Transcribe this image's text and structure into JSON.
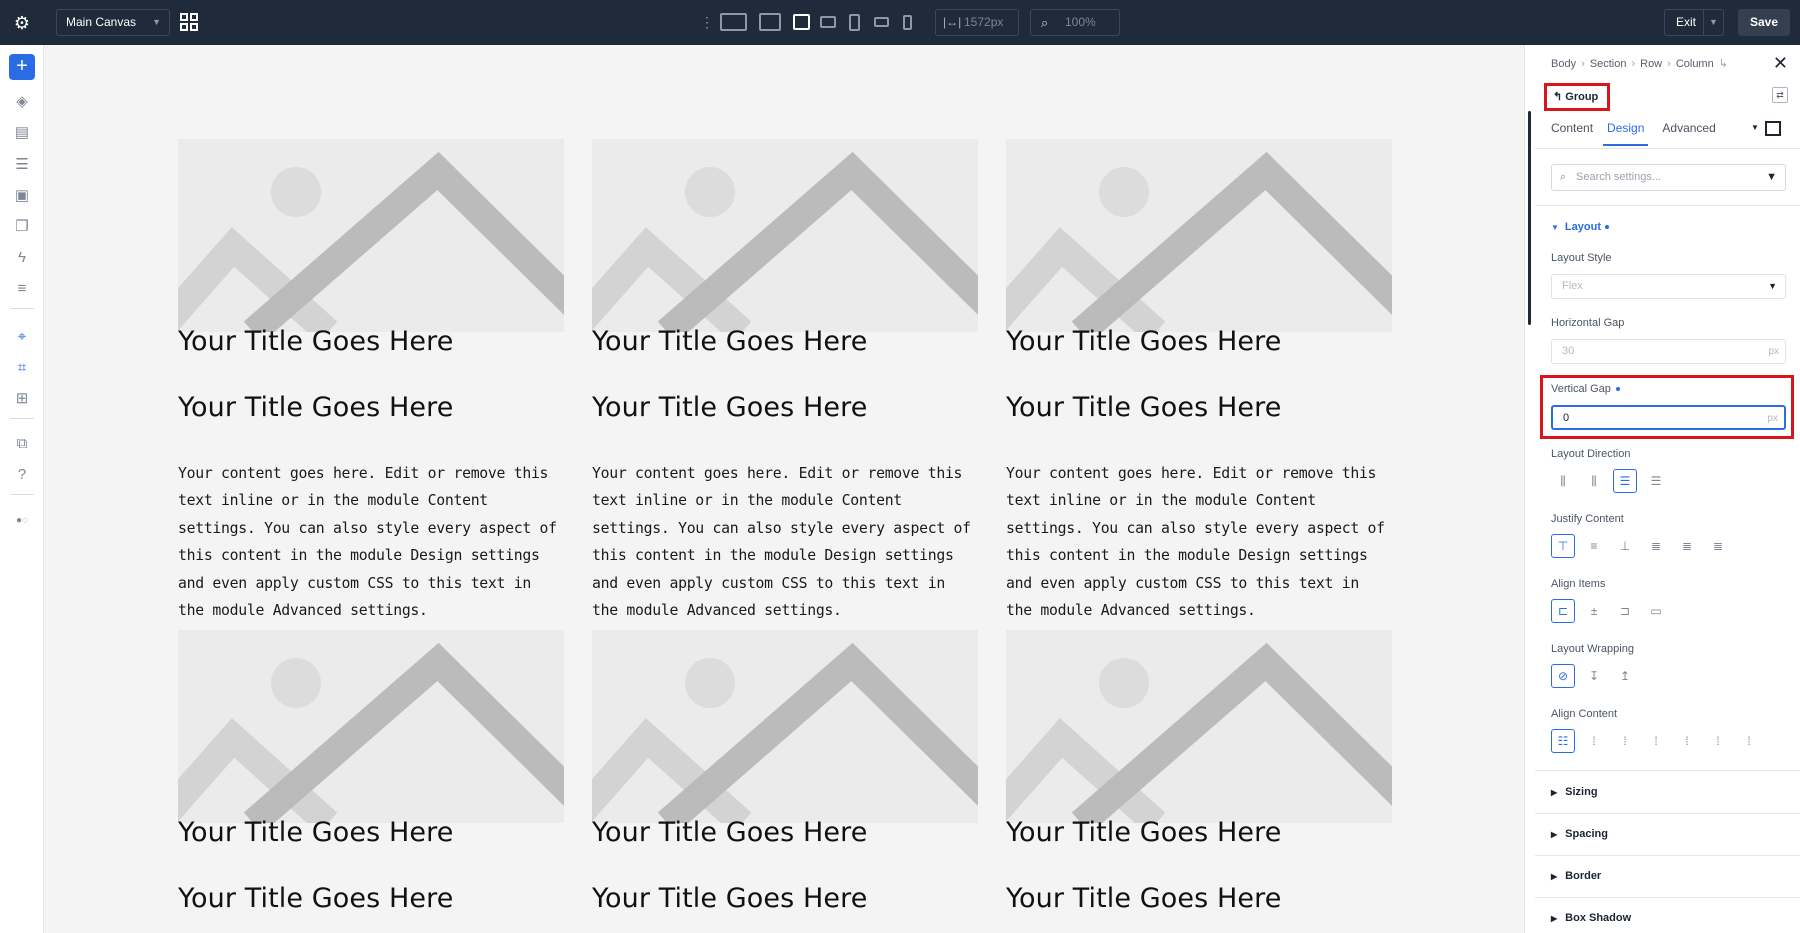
{
  "toolbar": {
    "canvas_select": "Main Canvas",
    "width_value": "1572px",
    "zoom_value": "100%",
    "exit_label": "Exit",
    "save_label": "Save"
  },
  "cards": [
    {
      "title1": "Your Title Goes Here",
      "title2": "Your Title Goes Here",
      "body": "Your content goes here. Edit or remove this text inline or in the module Content settings. You can also style every aspect of this content in the module Design settings and even apply custom CSS to this text in the module Advanced settings."
    },
    {
      "title1": "Your Title Goes Here",
      "title2": "Your Title Goes Here",
      "body": "Your content goes here. Edit or remove this text inline or in the module Content settings. You can also style every aspect of this content in the module Design settings and even apply custom CSS to this text in the module Advanced settings."
    },
    {
      "title1": "Your Title Goes Here",
      "title2": "Your Title Goes Here",
      "body": "Your content goes here. Edit or remove this text inline or in the module Content settings. You can also style every aspect of this content in the module Design settings and even apply custom CSS to this text in the module Advanced settings."
    },
    {
      "title1": "Your Title Goes Here",
      "title2": "Your Title Goes Here"
    },
    {
      "title1": "Your Title Goes Here",
      "title2": "Your Title Goes Here"
    },
    {
      "title1": "Your Title Goes Here",
      "title2": "Your Title Goes Here"
    }
  ],
  "panel": {
    "breadcrumb": [
      "Body",
      "Section",
      "Row",
      "Column"
    ],
    "group_label": "Group",
    "tabs": [
      "Content",
      "Design",
      "Advanced"
    ],
    "active_tab": "Design",
    "search_placeholder": "Search settings...",
    "layout_section": "Layout",
    "layout_style_label": "Layout Style",
    "layout_style_value": "Flex",
    "horizontal_gap_label": "Horizontal Gap",
    "horizontal_gap_placeholder": "30",
    "vertical_gap_label": "Vertical Gap",
    "vertical_gap_value": "0",
    "unit": "px",
    "layout_direction_label": "Layout Direction",
    "justify_content_label": "Justify Content",
    "align_items_label": "Align Items",
    "layout_wrapping_label": "Layout Wrapping",
    "align_content_label": "Align Content",
    "collapsed_sections": [
      "Sizing",
      "Spacing",
      "Border",
      "Box Shadow"
    ]
  },
  "colors": {
    "accent": "#2b6ce5",
    "highlight": "#d9151b",
    "topbar": "#1f2a3a"
  }
}
